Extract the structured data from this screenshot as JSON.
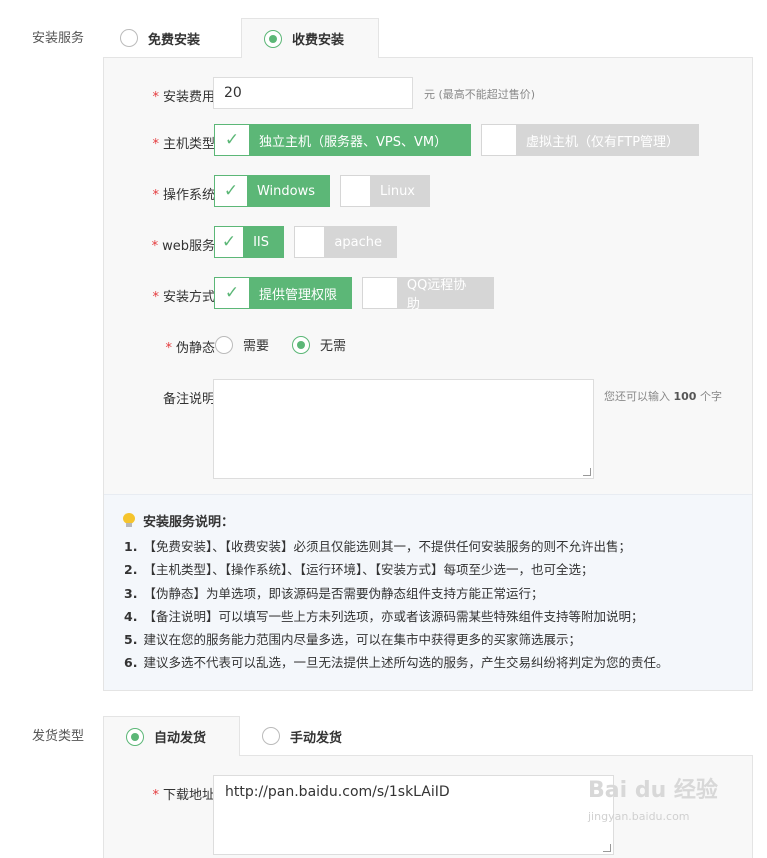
{
  "install_service": {
    "label": "安装服务",
    "tabs": [
      {
        "label": "免费安装",
        "selected": false
      },
      {
        "label": "收费安装",
        "selected": true
      }
    ],
    "fields": {
      "fee": {
        "label": "安装费用",
        "value": "20",
        "hint": "元 (最高不能超过售价)"
      },
      "host_type": {
        "label": "主机类型",
        "options": [
          {
            "label": "独立主机（服务器、VPS、VM）",
            "checked": true
          },
          {
            "label": "虚拟主机（仅有FTP管理）",
            "checked": false
          }
        ]
      },
      "os": {
        "label": "操作系统",
        "options": [
          {
            "label": "Windows",
            "checked": true
          },
          {
            "label": "Linux",
            "checked": false
          }
        ]
      },
      "web": {
        "label": "web服务",
        "options": [
          {
            "label": "IIS",
            "checked": true
          },
          {
            "label": "apache",
            "checked": false
          }
        ]
      },
      "method": {
        "label": "安装方式",
        "options": [
          {
            "label": "提供管理权限",
            "checked": true
          },
          {
            "label": "QQ远程协助",
            "checked": false
          }
        ]
      },
      "rewrite": {
        "label": "伪静态",
        "options": [
          {
            "label": "需要",
            "selected": false
          },
          {
            "label": "无需",
            "selected": true
          }
        ]
      },
      "remark": {
        "label": "备注说明",
        "value": "",
        "hint_prefix": "您还可以输入",
        "hint_count": "100",
        "hint_suffix": "个字"
      }
    },
    "notes": {
      "title": "安装服务说明：",
      "items": [
        {
          "num": "1.",
          "text": "【免费安装】、【收费安装】必须且仅能选则其一，不提供任何安装服务的则不允许出售；"
        },
        {
          "num": "2.",
          "text": "【主机类型】、【操作系统】、【运行环境】、【安装方式】每项至少选一，也可全选；"
        },
        {
          "num": "3.",
          "text": "【伪静态】为单选项，即该源码是否需要伪静态组件支持方能正常运行；"
        },
        {
          "num": "4.",
          "text": "【备注说明】可以填写一些上方未列选项，亦或者该源码需某些特殊组件支持等附加说明；"
        },
        {
          "num": "5.",
          "text": "建议在您的服务能力范围内尽量多选，可以在集市中获得更多的买家筛选展示；"
        },
        {
          "num": "6.",
          "text": "建议多选不代表可以乱选，一旦无法提供上述所勾选的服务，产生交易纠纷将判定为您的责任。"
        }
      ]
    }
  },
  "delivery": {
    "label": "发货类型",
    "tabs": [
      {
        "label": "自动发货",
        "selected": true
      },
      {
        "label": "手动发货",
        "selected": false
      }
    ],
    "download": {
      "label": "下载地址",
      "value": "http://pan.baidu.com/s/1skLAiID"
    }
  },
  "watermark": {
    "main": "Bai du 经验",
    "sub": "jingyan.baidu.com"
  },
  "colors": {
    "accent": "#5cb777",
    "required": "#e4393c",
    "disabled": "#d6d6d6"
  }
}
